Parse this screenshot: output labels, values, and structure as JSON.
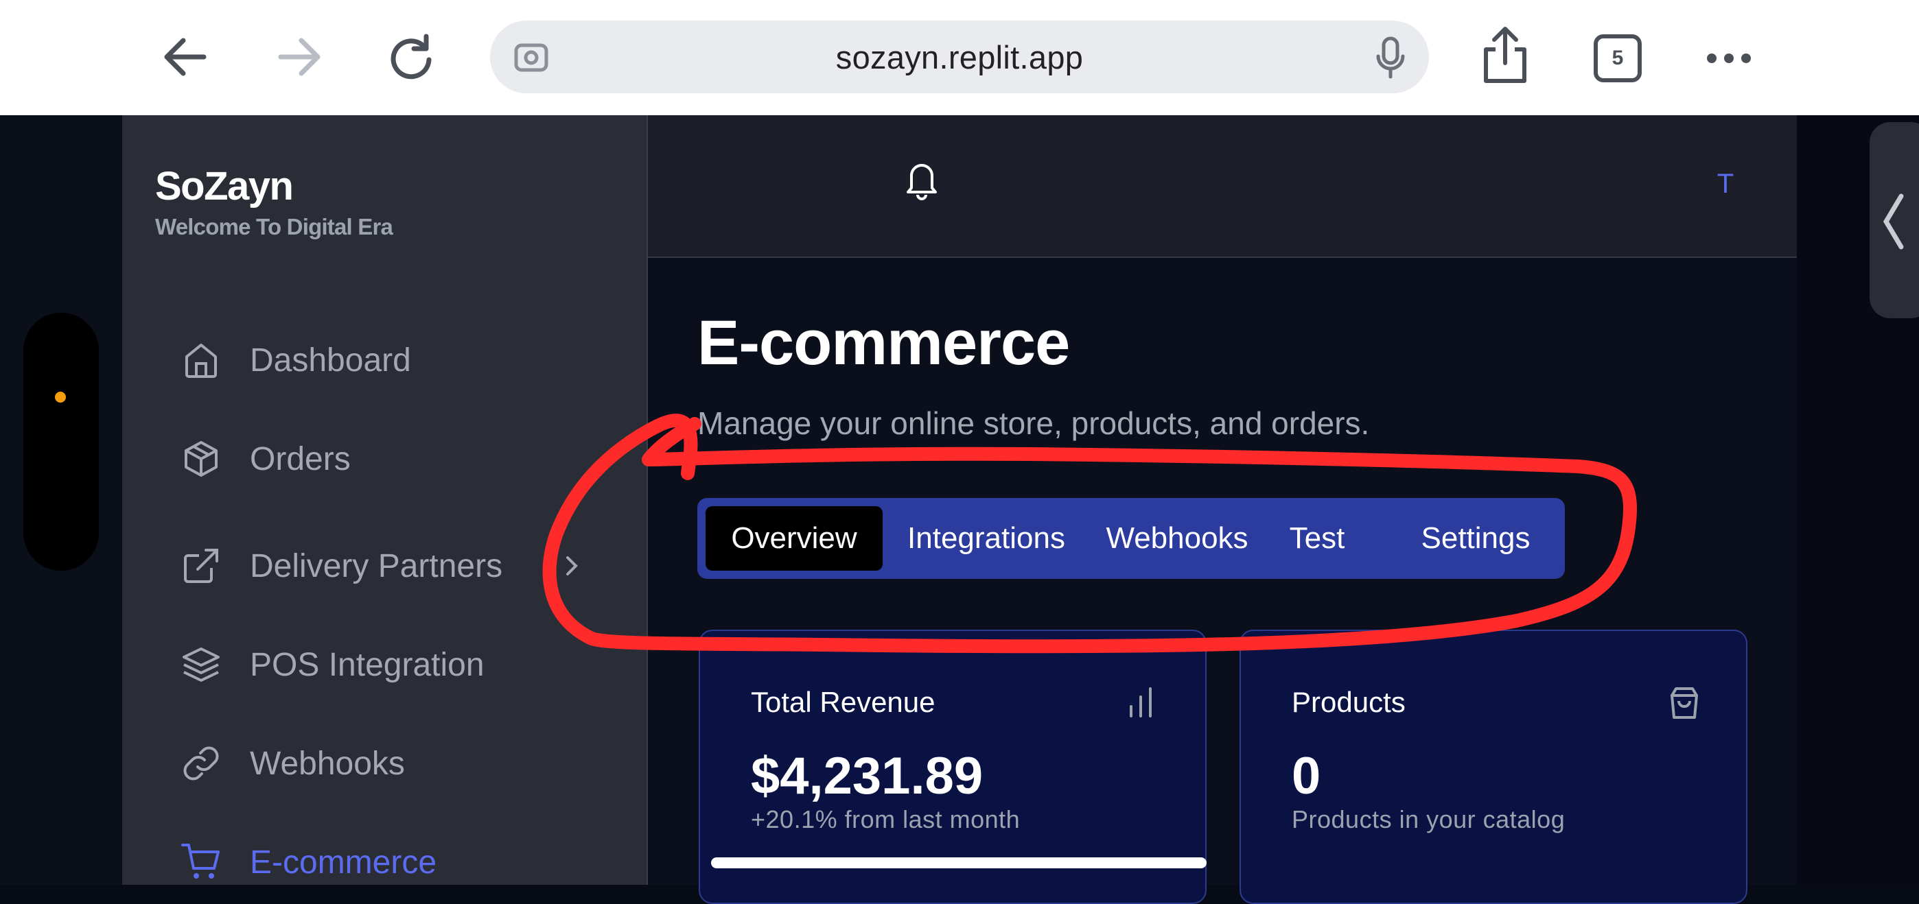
{
  "browser": {
    "url": "sozayn.replit.app",
    "tab_count": "5"
  },
  "app": {
    "brand": "SoZayn",
    "tagline": "Welcome To Digital Era",
    "avatar_initial": "T"
  },
  "sidebar": {
    "items": [
      {
        "label": "Dashboard",
        "icon": "home-icon"
      },
      {
        "label": "Orders",
        "icon": "package-icon"
      },
      {
        "label": "Delivery Partners",
        "icon": "external-link-icon"
      },
      {
        "label": "POS Integration",
        "icon": "layers-icon"
      },
      {
        "label": "Webhooks",
        "icon": "link-icon"
      },
      {
        "label": "E-commerce",
        "icon": "cart-icon",
        "active": true
      }
    ]
  },
  "page": {
    "title": "E-commerce",
    "subtitle": "Manage your online store, products, and orders.",
    "tabs": [
      "Overview",
      "Integrations",
      "Webhooks",
      "Test",
      "Settings"
    ],
    "active_tab": "Overview"
  },
  "cards": [
    {
      "title": "Total Revenue",
      "value": "$4,231.89",
      "sub": "+20.1% from last month",
      "icon": "bar-chart-icon"
    },
    {
      "title": "Products",
      "value": "0",
      "sub": "Products in your catalog",
      "icon": "shopping-bag-icon"
    }
  ],
  "colors": {
    "accent": "#5b6cf0",
    "tabs_bg": "#2b3b9e",
    "annotation": "#ff2a2a",
    "sidebar_bg": "#2a2d36",
    "main_bg": "#0b0f1c"
  }
}
